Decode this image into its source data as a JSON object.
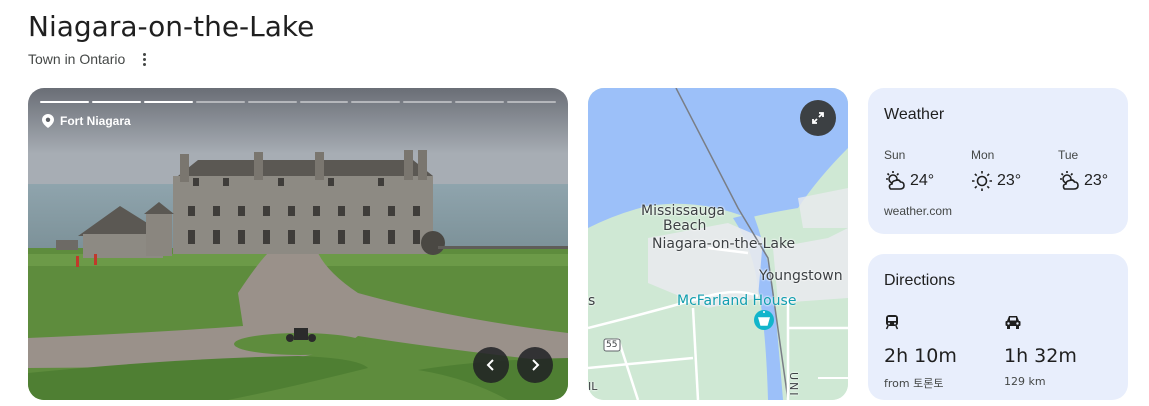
{
  "header": {
    "title": "Niagara-on-the-Lake",
    "subtitle": "Town in Ontario",
    "more_icon": "more-vert-icon"
  },
  "photo": {
    "place_label": "Fort Niagara",
    "pin_icon": "location-pin-icon",
    "slide_count": 10,
    "active_slide": 3,
    "prev_icon": "chevron-left-icon",
    "next_icon": "chevron-right-icon"
  },
  "map": {
    "labels": {
      "mississauga": "Mississauga",
      "beach": "Beach",
      "town": "Niagara-on-the-Lake",
      "youngstown": "Youngstown",
      "poi": "McFarland House",
      "edge_s": "s",
      "route": "55",
      "edge_il": "IL",
      "uni": "UNI"
    },
    "expand_icon": "expand-icon",
    "colors": {
      "water": "#9cc0f9",
      "land": "#cfe8d4",
      "urban": "#e8eaed"
    }
  },
  "weather": {
    "title": "Weather",
    "days": [
      {
        "day": "Sun",
        "temp": "24°",
        "icon": "partly-cloudy-icon"
      },
      {
        "day": "Mon",
        "temp": "23°",
        "icon": "sunny-icon"
      },
      {
        "day": "Tue",
        "temp": "23°",
        "icon": "partly-cloudy-icon"
      }
    ],
    "source": "weather.com"
  },
  "directions": {
    "title": "Directions",
    "routes": [
      {
        "mode": "transit",
        "icon": "train-icon",
        "time": "2h 10m",
        "sub": "from 토론토"
      },
      {
        "mode": "driving",
        "icon": "car-icon",
        "time": "1h 32m",
        "sub": "129 km"
      }
    ]
  }
}
